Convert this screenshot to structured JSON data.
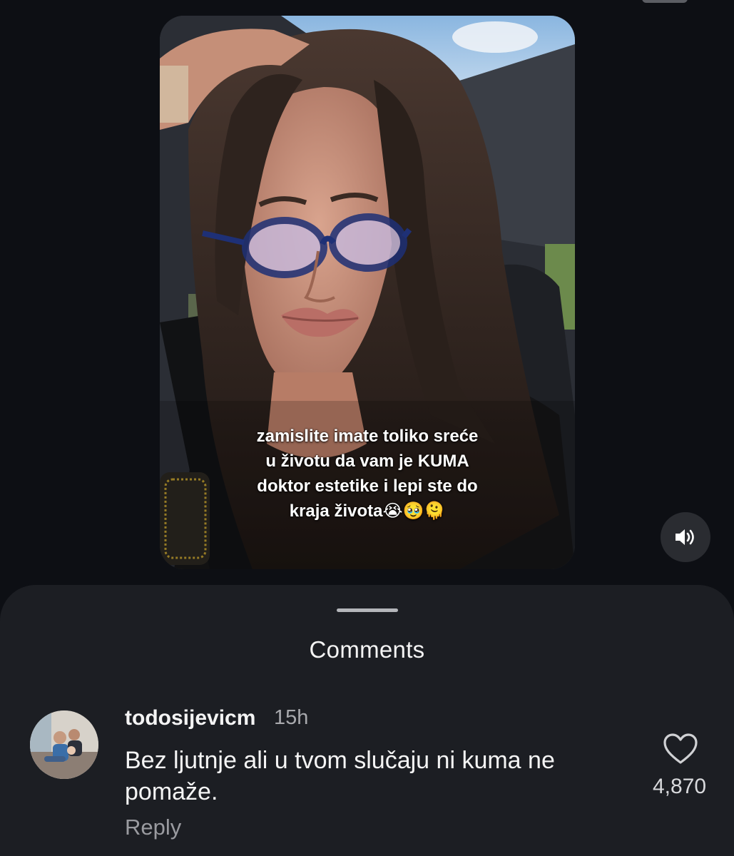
{
  "video": {
    "caption": "zamislite imate toliko sreće\nu životu da vam je KUMA\ndoktor estetike i lepi ste do\nkraja života😭🥹🫠",
    "sound_icon": "speaker-icon"
  },
  "comments_sheet": {
    "title": "Comments",
    "comments": [
      {
        "username": "todosijevicm",
        "time": "15h",
        "text": "Bez ljutnje ali u tvom slučaju ni kuma ne pomaže.",
        "likes": "4,870",
        "reply_label": "Reply",
        "like_icon": "heart-outline-icon"
      }
    ]
  },
  "colors": {
    "background": "#0d0f14",
    "sheet": "#1c1e23",
    "secondary_text": "#a8a9ad"
  }
}
